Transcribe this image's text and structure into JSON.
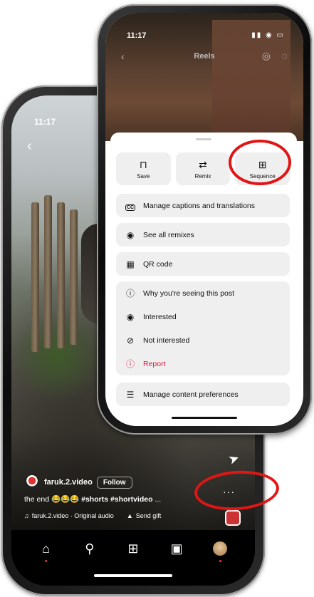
{
  "back_phone": {
    "time": "11:17",
    "author": {
      "username": "faruk.2.video",
      "follow_label": "Follow"
    },
    "caption": {
      "text": "the end",
      "emoji": "😂😂😂",
      "hashtags": "#shorts #shortvideo",
      "more": "..."
    },
    "audio": {
      "label": "faruk.2.video · Original audio",
      "gift_label": "Send gift"
    },
    "more_icon_glyph": "···",
    "nav": [
      "home-icon",
      "search-icon",
      "create-icon",
      "reels-icon",
      "profile-icon"
    ]
  },
  "front_phone": {
    "time": "11:17",
    "header": {
      "title": "Reels"
    },
    "sheet": {
      "top_buttons": [
        {
          "icon": "bookmark-icon",
          "label": "Save"
        },
        {
          "icon": "remix-icon",
          "label": "Remix"
        },
        {
          "icon": "sequence-icon",
          "label": "Sequence"
        }
      ],
      "groups": [
        [
          {
            "icon": "captions-icon",
            "label": "Manage captions and translations"
          }
        ],
        [
          {
            "icon": "eye-icon",
            "label": "See all remixes"
          }
        ],
        [
          {
            "icon": "qr-code-icon",
            "label": "QR code"
          }
        ],
        [
          {
            "icon": "info-icon",
            "label": "Why you're seeing this post"
          },
          {
            "icon": "eye-icon",
            "label": "Interested"
          },
          {
            "icon": "eye-off-icon",
            "label": "Not interested"
          },
          {
            "icon": "report-icon",
            "label": "Report",
            "color": "#e5163b"
          }
        ],
        [
          {
            "icon": "sliders-icon",
            "label": "Manage content preferences"
          }
        ]
      ]
    }
  },
  "highlight_color": "#e21515"
}
